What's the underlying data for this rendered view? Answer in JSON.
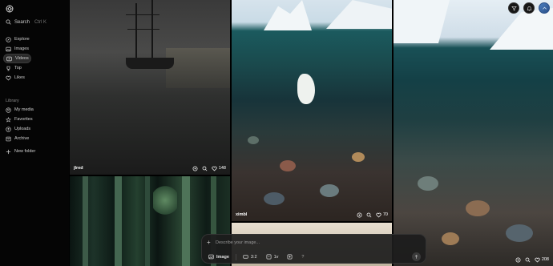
{
  "sidebar": {
    "search": {
      "label": "Search",
      "shortcut": "Ctrl K"
    },
    "nav": [
      {
        "label": "Explore",
        "icon": "compass-icon"
      },
      {
        "label": "Images",
        "icon": "image-icon"
      },
      {
        "label": "Videos",
        "icon": "video-icon",
        "active": true
      },
      {
        "label": "Top",
        "icon": "trophy-icon"
      },
      {
        "label": "Likes",
        "icon": "heart-icon"
      }
    ],
    "library_label": "Library",
    "library": [
      {
        "label": "My media",
        "icon": "user-icon"
      },
      {
        "label": "Favorites",
        "icon": "star-icon"
      },
      {
        "label": "Uploads",
        "icon": "upload-icon"
      },
      {
        "label": "Archive",
        "icon": "archive-icon"
      },
      {
        "label": "New folder",
        "icon": "plus-icon"
      }
    ]
  },
  "gallery": [
    {
      "author": "jlred",
      "likes": "148"
    },
    {
      "author": "ximbl",
      "likes": "70"
    },
    {
      "author": "",
      "likes": "208"
    }
  ],
  "prompt": {
    "placeholder": "Describe your image...",
    "mode": "Image",
    "aspect": "3:2",
    "count": "1v",
    "help": "?"
  },
  "colors": {
    "background": "#000000",
    "sidebar": "#050505",
    "accent_avatar": "#3a6fb0"
  }
}
